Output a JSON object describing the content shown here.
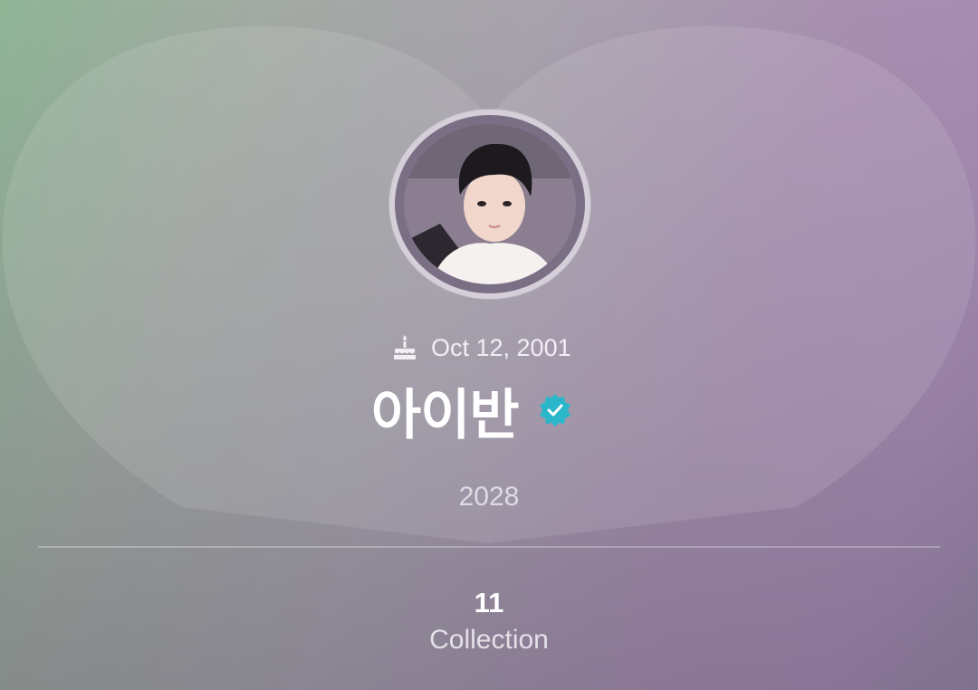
{
  "profile": {
    "birthday": "Oct 12, 2001",
    "name": "아이반",
    "group_label": "2028",
    "verified": true,
    "avatar_icon": "person-photo",
    "cake_icon": "birthday-cake-icon",
    "verified_icon": "verified-badge-icon"
  },
  "stats": {
    "collection_count": "11",
    "collection_label": "Collection"
  },
  "colors": {
    "verified_badge": "#2bb7c9",
    "background_left": "#8fb596",
    "background_right": "#a78bb3"
  }
}
